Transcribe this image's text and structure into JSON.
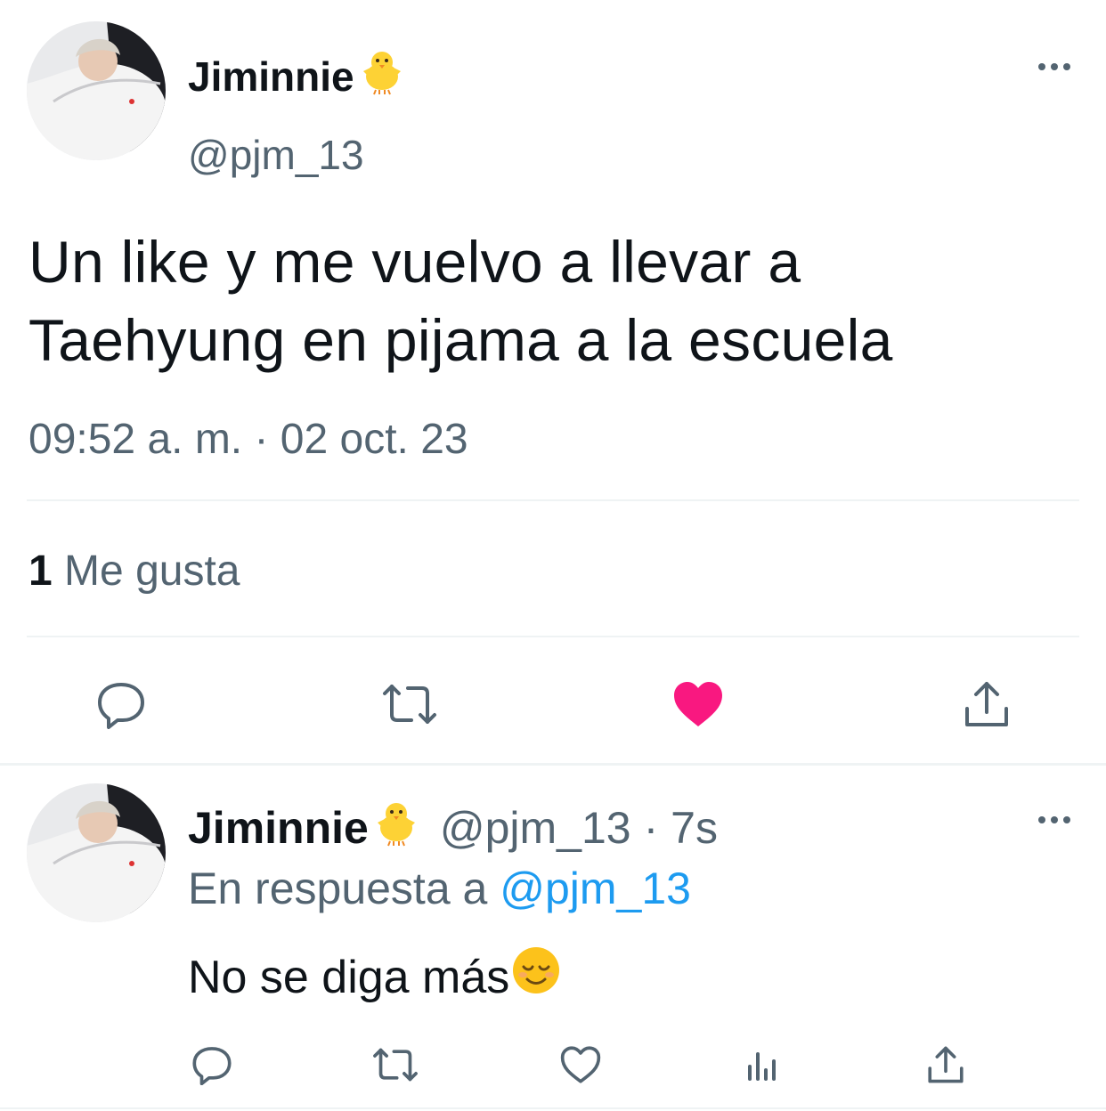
{
  "main_tweet": {
    "display_name": "Jiminnie",
    "name_emoji": "baby-chick-emoji",
    "handle": "@pjm_13",
    "text_line1": "Un like y me vuelvo a llevar a",
    "text_line2": "Taehyung en pijama a la escuela",
    "timestamp": "09:52 a. m. · 02 oct. 23",
    "likes_count": "1",
    "likes_label": "Me gusta",
    "liked": true,
    "colors": {
      "like_active": "#f91880",
      "icon_grey": "#536471"
    }
  },
  "reply_tweet": {
    "display_name": "Jiminnie",
    "handle": "@pjm_13",
    "time_ago": "· 7s",
    "reply_prefix": "En respuesta a",
    "reply_to": "@pjm_13",
    "text": "No se diga más",
    "text_emoji": "relieved-face-emoji"
  },
  "colors": {
    "accent": "#1d9bf0",
    "text": "#0f1419",
    "secondary": "#536471"
  }
}
